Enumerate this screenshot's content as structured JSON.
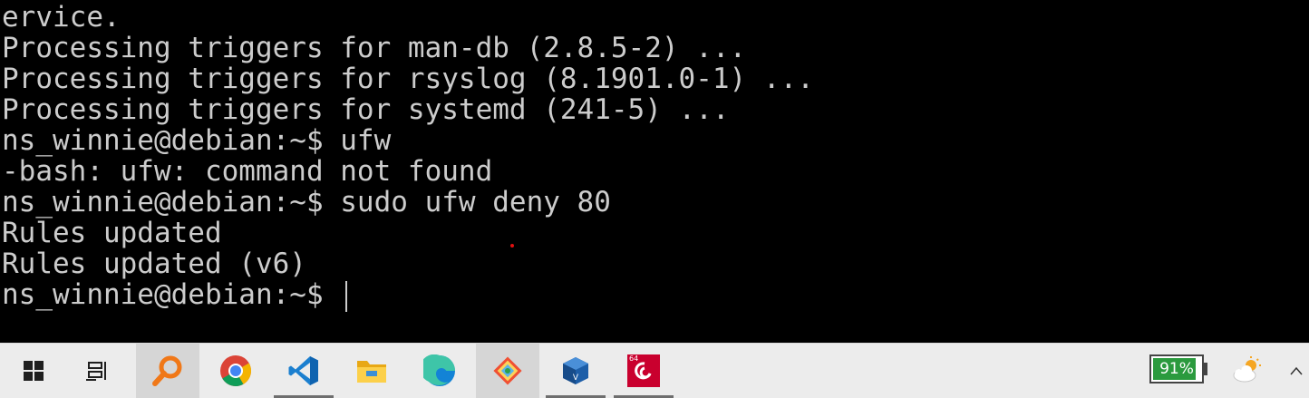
{
  "terminal": {
    "lines": [
      "ervice.",
      "Processing triggers for man-db (2.8.5-2) ...",
      "Processing triggers for rsyslog (8.1901.0-1) ...",
      "Processing triggers for systemd (241-5) ...",
      "ns_winnie@debian:~$ ufw",
      "-bash: ufw: command not found",
      "ns_winnie@debian:~$ sudo ufw deny 80",
      "Rules updated",
      "Rules updated (v6)",
      "ns_winnie@debian:~$ "
    ],
    "text_color": "#cccccc",
    "background": "#000000"
  },
  "taskbar": {
    "items": [
      {
        "name": "start",
        "icon": "windows-logo-icon"
      },
      {
        "name": "task-view",
        "icon": "task-view-icon"
      },
      {
        "name": "search",
        "icon": "search-icon",
        "active": true
      },
      {
        "name": "chrome",
        "icon": "chrome-icon"
      },
      {
        "name": "vscode",
        "icon": "vscode-icon",
        "running": true
      },
      {
        "name": "file-explorer",
        "icon": "folder-icon"
      },
      {
        "name": "edge",
        "icon": "edge-icon"
      },
      {
        "name": "git",
        "icon": "git-icon",
        "active": true
      },
      {
        "name": "virtualbox",
        "icon": "virtualbox-icon",
        "running": true
      },
      {
        "name": "debian",
        "icon": "debian-icon",
        "running": true
      }
    ],
    "debian_badge": "64",
    "battery": {
      "label": "91%",
      "level": 0.91
    },
    "weather_icon": "cloud-sun-icon",
    "chevron_icon": "chevron-up-icon",
    "background": "#ececec"
  }
}
